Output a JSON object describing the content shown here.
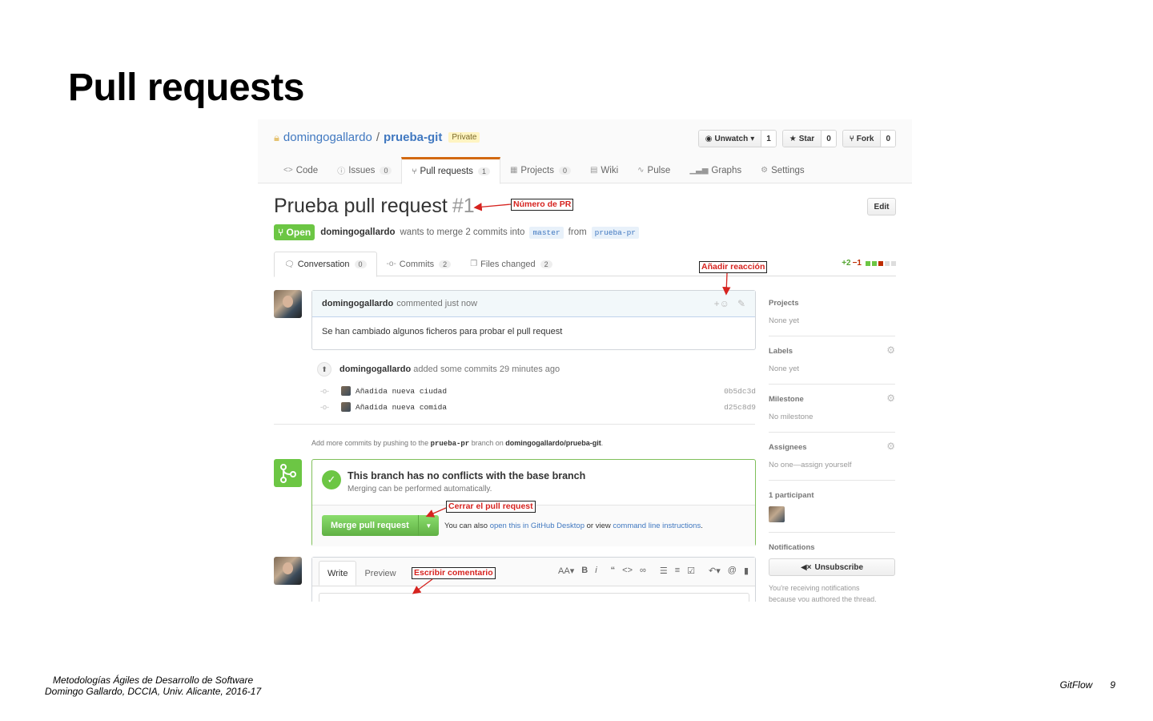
{
  "slide": {
    "title": "Pull requests",
    "footer_line1": "Metodologías Ágiles de Desarrollo de Software",
    "footer_line2": "Domingo Gallardo, DCCIA, Univ. Alicante, 2016-17",
    "section": "GitFlow",
    "page_number": "9"
  },
  "repo": {
    "owner": "domingogallardo",
    "separator": "/",
    "name": "prueba-git",
    "visibility": "Private",
    "lock_icon": "lock-icon"
  },
  "repo_actions": {
    "watch_label": "Unwatch",
    "watch_count": "1",
    "star_label": "Star",
    "star_count": "0",
    "fork_label": "Fork",
    "fork_count": "0"
  },
  "repo_nav": {
    "code": "Code",
    "issues": "Issues",
    "issues_count": "0",
    "pull_requests": "Pull requests",
    "pull_requests_count": "1",
    "projects": "Projects",
    "projects_count": "0",
    "wiki": "Wiki",
    "pulse": "Pulse",
    "graphs": "Graphs",
    "settings": "Settings",
    "selected": "Pull requests"
  },
  "pr": {
    "title": "Prueba pull request",
    "number": "#1",
    "edit_label": "Edit",
    "state": "Open",
    "author": "domingogallardo",
    "merge_text": "wants to merge 2 commits into",
    "base_branch": "master",
    "from_text": "from",
    "head_branch": "prueba-pr"
  },
  "pr_tabs": {
    "conversation": "Conversation",
    "conversation_count": "0",
    "commits": "Commits",
    "commits_count": "2",
    "files_changed": "Files changed",
    "files_changed_count": "2",
    "additions": "+2",
    "deletions": "−1",
    "diff_colors": [
      "#6cc644",
      "#6cc644",
      "#bd2c00",
      "#dddddd",
      "#dddddd"
    ]
  },
  "comment": {
    "author": "domingogallardo",
    "meta": "commented just now",
    "body": "Se han cambiado algunos ficheros para probar el pull request"
  },
  "commits_event": {
    "author": "domingogallardo",
    "text": "added some commits 29 minutes ago",
    "commits": [
      {
        "message": "Añadida nueva ciudad",
        "sha": "0b5dc3d"
      },
      {
        "message": "Añadida nueva comida",
        "sha": "d25c8d9"
      }
    ]
  },
  "add_more": {
    "prefix": "Add more commits by pushing to the",
    "branch": "prueba-pr",
    "middle": "branch on",
    "repo": "domingogallardo/prueba-git",
    "suffix": "."
  },
  "merge": {
    "heading": "This branch has no conflicts with the base branch",
    "subheading": "Merging can be performed automatically.",
    "button_label": "Merge pull request",
    "alt_prefix": "You can also",
    "alt_link1": "open this in GitHub Desktop",
    "alt_middle": "or view",
    "alt_link2": "command line instructions",
    "alt_suffix": "."
  },
  "write": {
    "write_tab": "Write",
    "preview_tab": "Preview",
    "text_size": "AA",
    "bold": "B",
    "italic": "i"
  },
  "sidebar": {
    "projects_title": "Projects",
    "projects_value": "None yet",
    "labels_title": "Labels",
    "labels_value": "None yet",
    "milestone_title": "Milestone",
    "milestone_value": "No milestone",
    "assignees_title": "Assignees",
    "assignees_value": "No one—assign yourself",
    "participants_title": "1 participant",
    "notifications_title": "Notifications",
    "unsubscribe_label": "Unsubscribe",
    "notifications_note_1": "You're receiving notifications",
    "notifications_note_2": "because you authored the thread."
  },
  "callouts": {
    "pr_number": "Número de PR",
    "add_reaction": "Añadir reacción",
    "close_pr": "Cerrar el pull request",
    "write_comment": "Escribir comentario"
  },
  "colors": {
    "accent_link": "#4078c0",
    "open_green": "#6cc644",
    "callout_red": "#d6231f",
    "selected_tab_orange": "#d26911"
  }
}
